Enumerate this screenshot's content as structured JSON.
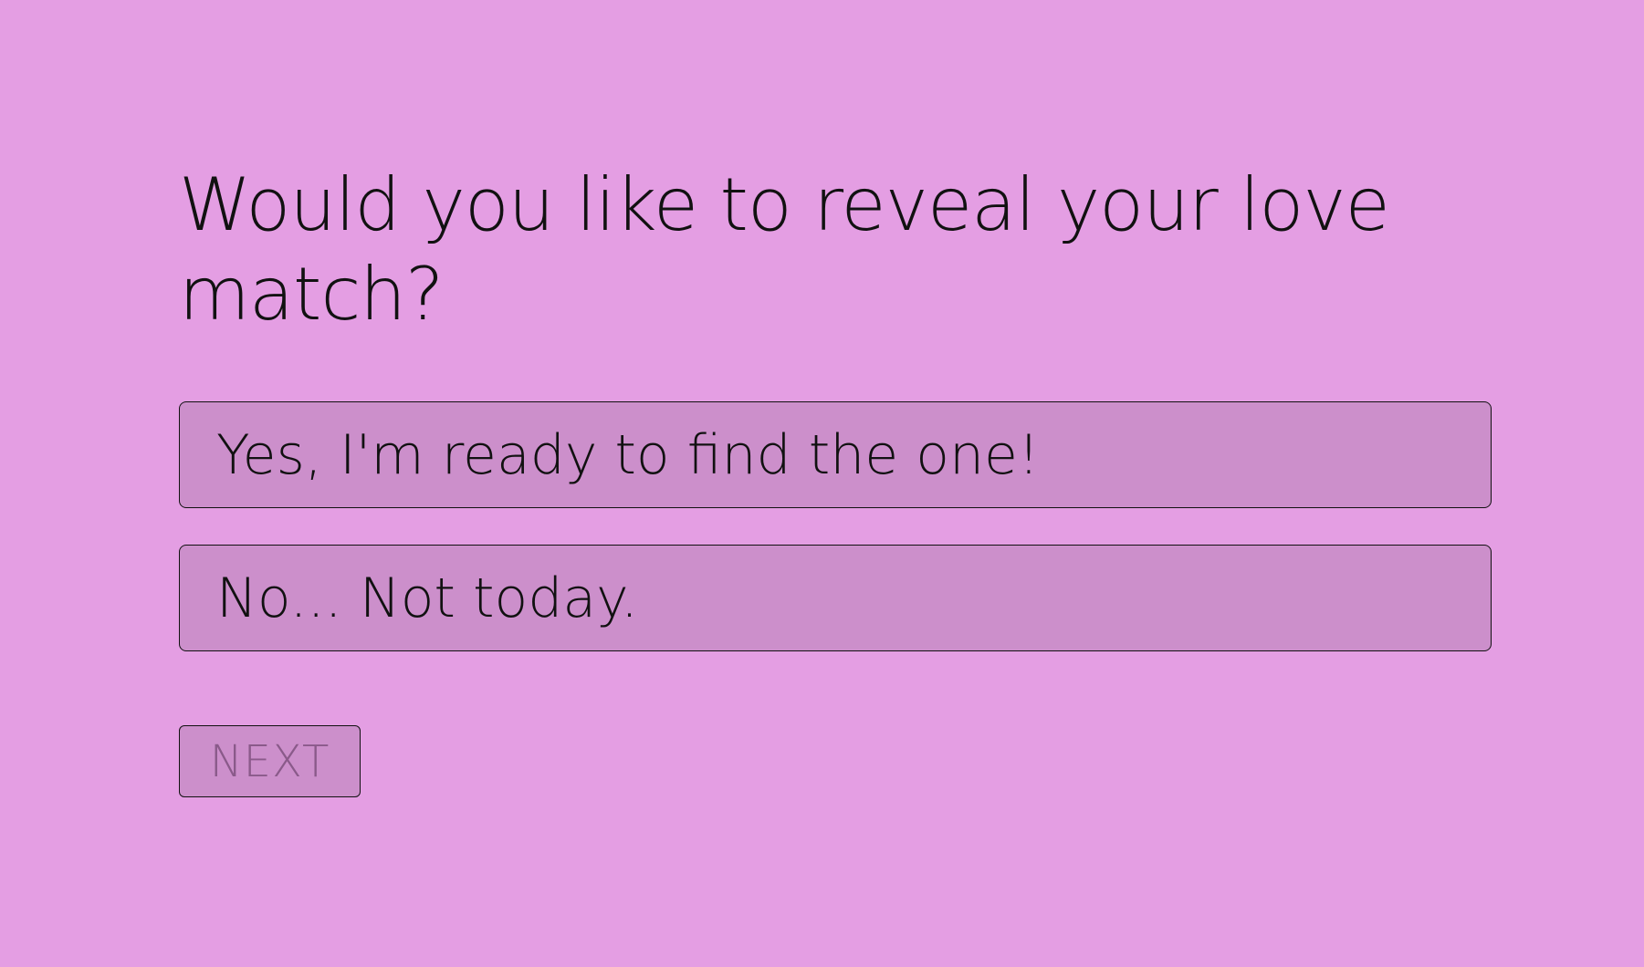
{
  "theme": {
    "background": "#e49ee3",
    "option_background": "#cc8fcb",
    "border": "#111111",
    "text": "#111111",
    "disabled_text": "#8a5a8a"
  },
  "question": {
    "text": "Would you like to reveal your love match?"
  },
  "options": [
    {
      "label": "Yes, I'm ready to find the one!"
    },
    {
      "label": "No... Not today."
    }
  ],
  "next_button": {
    "label": "NEXT",
    "disabled": true
  }
}
